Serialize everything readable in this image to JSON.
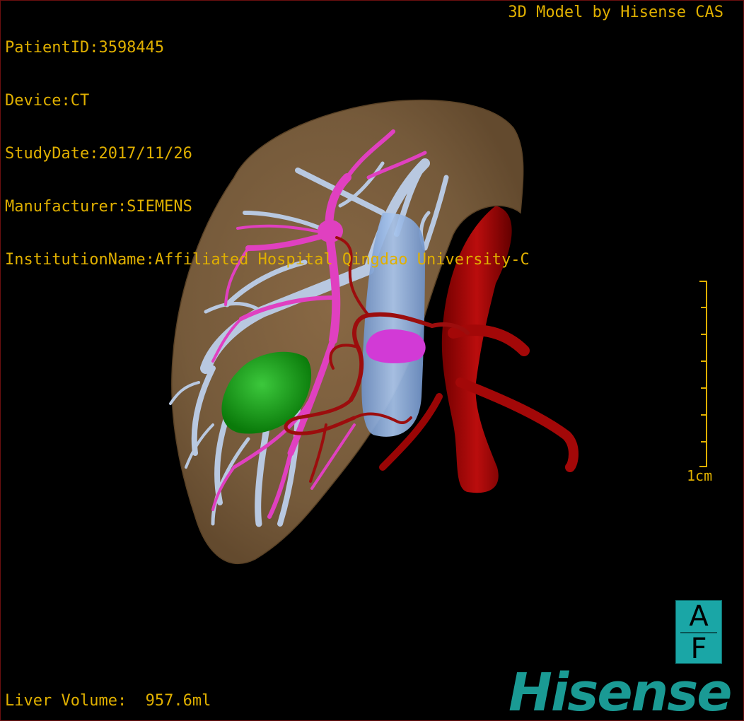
{
  "patient_info": {
    "patient_id": "PatientID:3598445",
    "device": "Device:CT",
    "study_date": "StudyDate:2017/11/26",
    "manufacturer": "Manufacturer:SIEMENS",
    "institution": "InstitutionName:Affiliated Hospital Qingdao University-C"
  },
  "header_right": "3D Model by Hisense CAS",
  "liver_volume": "Liver Volume:  957.6ml",
  "scale": {
    "label": "1cm"
  },
  "orientation": {
    "top_letter": "A",
    "bottom_letter": "F"
  },
  "logo_text": "Hisense",
  "colors": {
    "overlay_text": "#e0b000",
    "liver": "#8a6a45",
    "portal_vein": "#b8c8e0",
    "hepatic_vein": "#e040c0",
    "artery": "#b00000",
    "tumor": "#10a010",
    "ivc": "#8fb4e6",
    "brand": "#1a9a94"
  }
}
